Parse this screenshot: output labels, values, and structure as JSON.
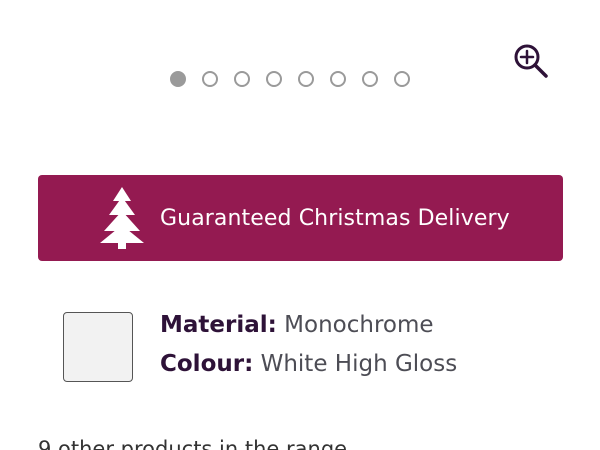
{
  "gallery": {
    "zoom_icon": "zoom-in-icon",
    "dot_count": 8,
    "active_index": 0
  },
  "banner": {
    "icon": "christmas-tree-icon",
    "text": "Guaranteed Christmas Delivery",
    "background_color": "#941a51",
    "text_color": "#ffffff"
  },
  "product": {
    "swatch_color": "#f2f2f2",
    "material_label": "Material:",
    "material_value": "Monochrome",
    "colour_label": "Colour:",
    "colour_value": "White High Gloss"
  },
  "range": {
    "link_text": "9 other products in the range"
  }
}
